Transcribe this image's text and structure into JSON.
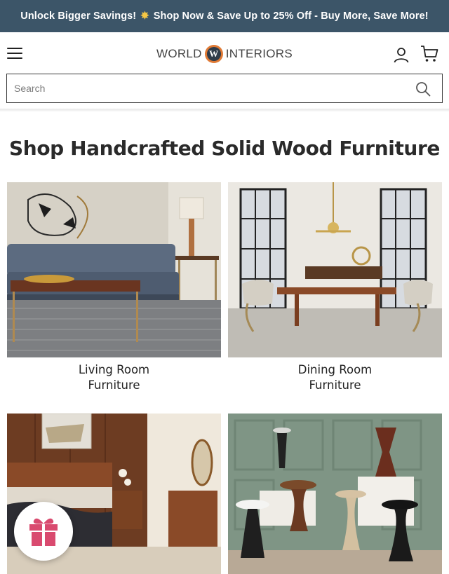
{
  "promo": {
    "text_before": "Unlock Bigger Savings!",
    "icon": "sparkle-burst",
    "text_after": "Shop Now & Save Up to 25% Off - Buy More, Save More!"
  },
  "header": {
    "logo_left": "WORLD",
    "logo_mark": "W",
    "logo_right": "INTERIORS",
    "menu_icon": "hamburger-icon",
    "account_icon": "user-icon",
    "cart_icon": "cart-icon"
  },
  "search": {
    "placeholder": "Search",
    "value": "",
    "icon": "search-icon"
  },
  "main": {
    "heading": "Shop Handcrafted Solid Wood Furniture",
    "categories": [
      {
        "line1": "Living Room",
        "line2": "Furniture"
      },
      {
        "line1": "Dining Room",
        "line2": "Furniture"
      },
      {
        "line1": "",
        "line2": ""
      },
      {
        "line1": "",
        "line2": ""
      }
    ]
  },
  "floating": {
    "gift_icon": "gift-icon"
  },
  "colors": {
    "promo_bg": "#3c5568",
    "logo_orange": "#e07a35",
    "gift_pink": "#d94a6f"
  }
}
